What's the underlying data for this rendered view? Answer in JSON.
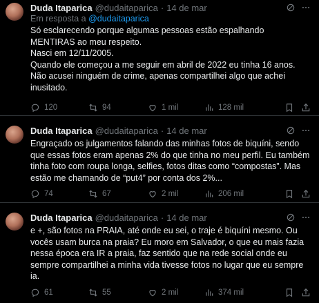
{
  "tweets": [
    {
      "name": "Duda Itaparica",
      "handle": "@dudaitaparica",
      "dot": "·",
      "date": "14 de mar",
      "reply_prefix": "Em resposta a ",
      "reply_handle": "@dudaitaparica",
      "text": "Só esclarecendo porque algumas pessoas estão espalhando MENTIRAS ao meu respeito.\nNasci em 12/11/2005.\nQuando ele começou a me seguir em abril de 2022 eu tinha 16 anos.\nNão acusei ninguém de crime, apenas compartilhei algo que achei inusitado.",
      "replies": "120",
      "retweets": "94",
      "likes": "1 mil",
      "views": "128 mil"
    },
    {
      "name": "Duda Itaparica",
      "handle": "@dudaitaparica",
      "dot": "·",
      "date": "14 de mar",
      "text": "Engraçado os julgamentos falando das minhas fotos de biquíni, sendo que essas fotos eram apenas 2% do que tinha no meu perfil. Eu também tinha foto com roupa longa, selfies, fotos ditas como “compostas”. Mas estão me chamando de “put4” por conta dos 2%...",
      "replies": "74",
      "retweets": "67",
      "likes": "2 mil",
      "views": "206 mil"
    },
    {
      "name": "Duda Itaparica",
      "handle": "@dudaitaparica",
      "dot": "·",
      "date": "14 de mar",
      "text": "e +, são fotos na PRAIA, até onde eu sei, o traje é biquíni mesmo. Ou vocês usam burca na praia? Eu moro em Salvador, o que eu mais fazia nessa época era IR a praia, faz sentido que na rede social onde eu sempre compartilhei a minha vida tivesse fotos no lugar que eu sempre ia.",
      "replies": "61",
      "retweets": "55",
      "likes": "2 mil",
      "views": "374 mil"
    }
  ],
  "colors": {
    "background": "#000000",
    "text": "#e7e9ea",
    "muted": "#71767b",
    "link": "#1d9bf0",
    "divider": "#2f3336"
  },
  "icons": {
    "header": [
      "grok-icon",
      "more-icon"
    ],
    "actions": [
      "reply-icon",
      "retweet-icon",
      "like-icon",
      "views-icon",
      "bookmark-icon",
      "share-icon"
    ]
  }
}
